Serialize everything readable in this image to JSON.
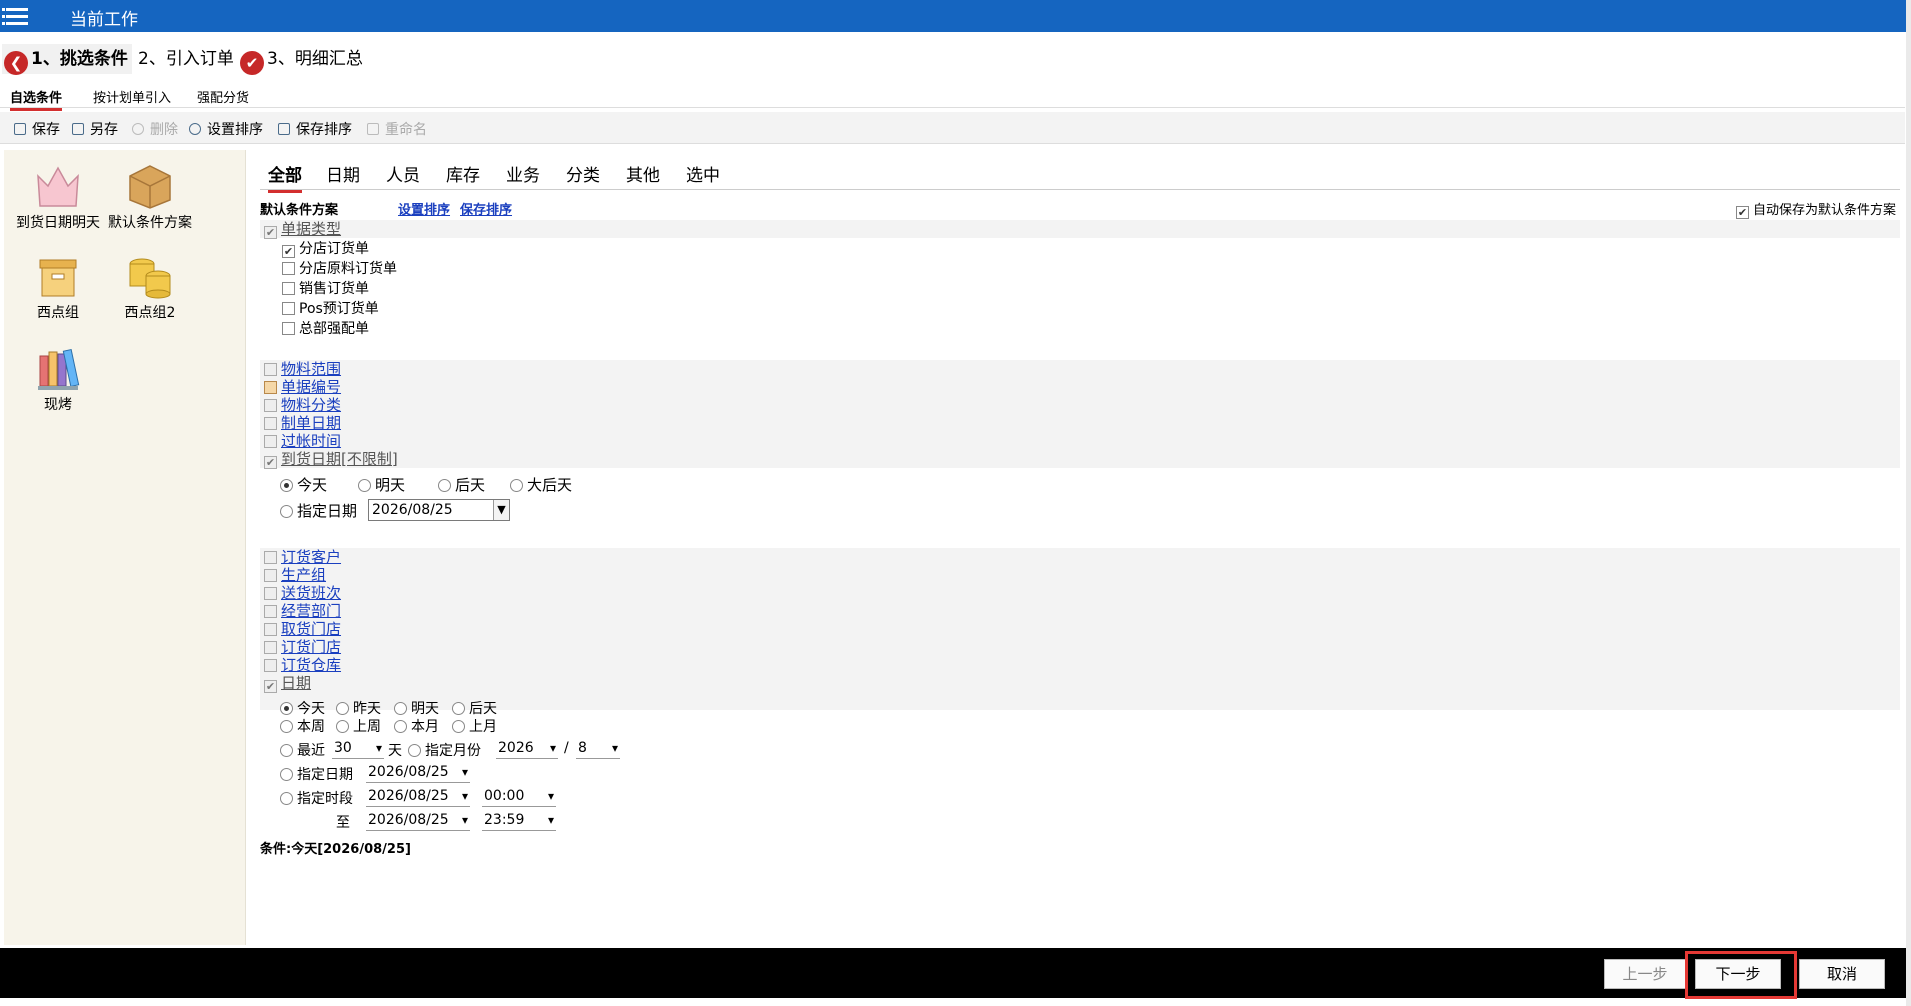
{
  "title": "当前工作",
  "steps": [
    {
      "label": "1、挑选条件"
    },
    {
      "label": "2、引入订单"
    },
    {
      "label": "3、明细汇总"
    }
  ],
  "subtabs": [
    "自选条件",
    "按计划单引入",
    "强配分货"
  ],
  "toolbar": {
    "save": "保存",
    "save_as": "另存",
    "delete": "删除",
    "set_sort": "设置排序",
    "save_sort": "保存排序",
    "rename": "重命名"
  },
  "left_panel": [
    "到货日期明天",
    "默认条件方案",
    "西点组",
    "西点组2",
    "现烤"
  ],
  "cond_tabs": [
    "全部",
    "日期",
    "人员",
    "库存",
    "业务",
    "分类",
    "其他",
    "选中"
  ],
  "scheme": {
    "label": "默认条件方案",
    "set_sort": "设置排序",
    "save_sort": "保存排序",
    "autosave": "自动保存为默认条件方案"
  },
  "doc_type": {
    "title": "单据类型",
    "options": [
      "分店订货单",
      "分店原料订货单",
      "销售订货单",
      "Pos预订货单",
      "总部强配单"
    ]
  },
  "links1": [
    "物料范围",
    "单据编号",
    "物料分类",
    "制单日期",
    "过帐时间"
  ],
  "arrival": {
    "title": "到货日期[不限制]",
    "r": [
      "今天",
      "明天",
      "后天",
      "大后天"
    ],
    "specify": "指定日期",
    "date": "2026/08/25"
  },
  "links2": [
    "订货客户",
    "生产组",
    "送货班次",
    "经营部门",
    "取货门店",
    "订货门店",
    "订货仓库"
  ],
  "date": {
    "title": "日期",
    "r1": [
      "今天",
      "昨天",
      "明天",
      "后天"
    ],
    "r2": [
      "本周",
      "上周",
      "本月",
      "上月"
    ],
    "recent": "最近",
    "recent_val": "30",
    "day": "天",
    "spec_month": "指定月份",
    "year": "2026",
    "slash": "/",
    "month": "8",
    "spec_date": "指定日期",
    "spec_date_val": "2026/08/25",
    "period": "指定时段",
    "p_from": "2026/08/25",
    "t_from": "00:00",
    "to": "至",
    "p_to": "2026/08/25",
    "t_to": "23:59"
  },
  "status": "条件:今天[2026/08/25]",
  "buttons": {
    "prev": "上一步",
    "next": "下一步",
    "cancel": "取消"
  }
}
